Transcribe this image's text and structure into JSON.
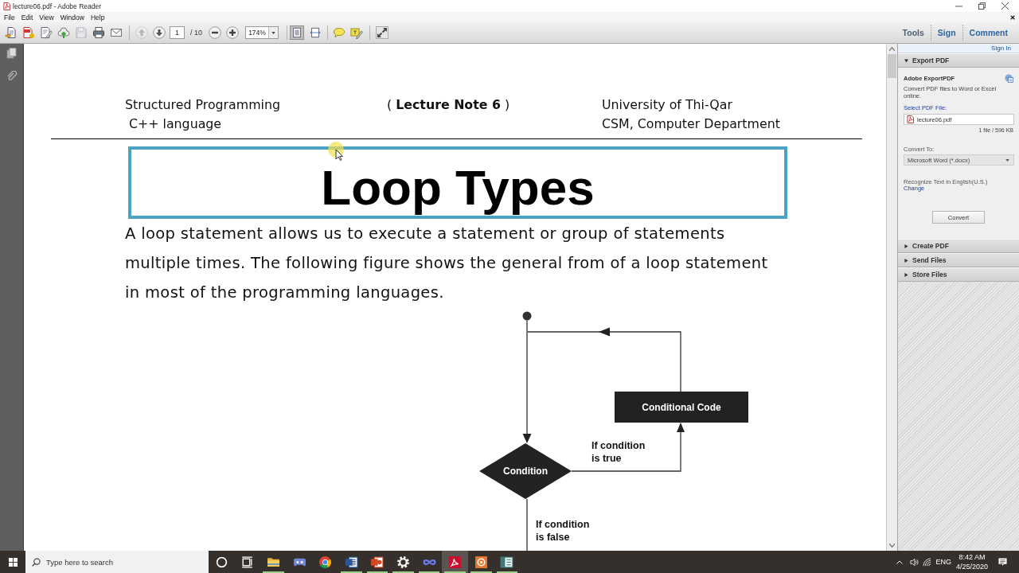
{
  "window": {
    "title": "lecture06.pdf - Adobe Reader"
  },
  "menu": [
    "File",
    "Edit",
    "View",
    "Window",
    "Help"
  ],
  "toolbar": {
    "file_tools": [
      {
        "disabled": false
      },
      {
        "disabled": false
      },
      {
        "disabled": false
      },
      {
        "disabled": false
      },
      {
        "disabled": true
      },
      {
        "disabled": false
      },
      {
        "disabled": false
      }
    ],
    "previous_page": {
      "disabled": true
    },
    "next_page": {
      "disabled": false
    },
    "page": "1",
    "page_count": "/ 10",
    "zoom": "174%",
    "view_modes": [
      {
        "selected": true
      },
      {
        "selected": false
      }
    ],
    "panes": [
      "Tools",
      "Sign",
      "Comment"
    ]
  },
  "document": {
    "header_left": [
      "Structured Programming",
      "C++ language"
    ],
    "header_center": "( **Lecture Note 6** )",
    "header_right": [
      "University of Thi-Qar",
      "CSM, Computer Department"
    ],
    "title": "Loop Types",
    "paragraph": "A loop statement allows us to execute a statement or group of statements multiple times. The following figure shows the general from of a loop statement in most of the programming languages.",
    "diagram": {
      "process": "Conditional Code",
      "decision": "Condition",
      "true_label": "If condition is true",
      "false_label": "If condition is false"
    }
  },
  "side_panel": {
    "sign_in": "Sign In",
    "sections": [
      {
        "title": "Export PDF",
        "expanded": true
      },
      {
        "title": "Create PDF",
        "expanded": false
      },
      {
        "title": "Send Files",
        "expanded": false
      },
      {
        "title": "Store Files",
        "expanded": false
      }
    ],
    "export_pdf": {
      "heading": "Adobe ExportPDF",
      "description": "Convert PDF files to Word or Excel online.",
      "select_label": "Select PDF File:",
      "file": "lecture06.pdf",
      "file_info": "1 file / 596 KB",
      "convert_to_label": "Convert To:",
      "convert_to": "Microsoft Word (*.docx)",
      "ocr_text": "Recognize Text in English(U.S.)",
      "change_link": "Change",
      "convert_button": "Convert"
    }
  },
  "taskbar": {
    "search": {
      "placeholder": "Type here to search"
    },
    "apps": [
      {
        "running": true,
        "selected": false
      },
      {
        "running": false,
        "selected": false
      },
      {
        "running": false,
        "selected": false
      },
      {
        "running": true,
        "selected": false
      },
      {
        "running": true,
        "selected": false
      },
      {
        "running": true,
        "selected": false
      },
      {
        "running": true,
        "selected": false
      },
      {
        "running": true,
        "selected": true
      },
      {
        "running": true,
        "selected": false
      },
      {
        "running": true,
        "selected": false
      }
    ],
    "language": "ENG",
    "time": "8:42 AM",
    "date": "4/25/2020"
  }
}
